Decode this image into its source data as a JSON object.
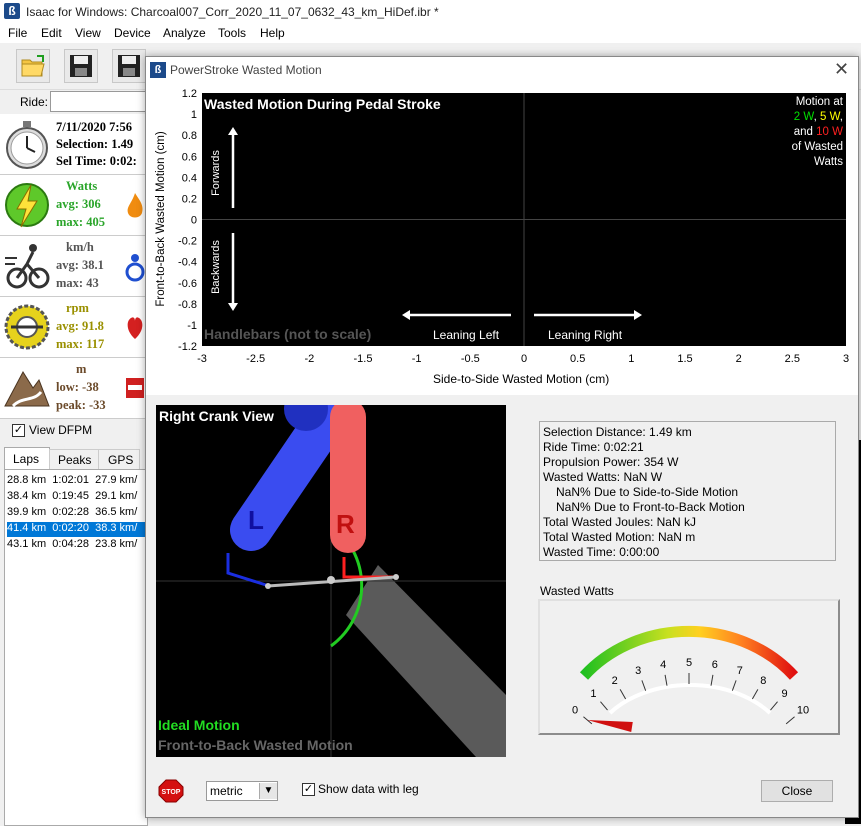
{
  "window": {
    "title": "Isaac for Windows:  Charcoal007_Corr_2020_11_07_0632_43_km_HiDef.ibr *",
    "menu": [
      "File",
      "Edit",
      "View",
      "Device",
      "Analyze",
      "Tools",
      "Help"
    ]
  },
  "ride": {
    "label": "Ride:"
  },
  "summary": {
    "date": "7/11/2020 7:56",
    "selection": "Selection: 1.49",
    "sel_time": "Sel Time: 0:02:"
  },
  "watts": {
    "label": "Watts",
    "avg": "avg: 306",
    "max": "max: 405"
  },
  "speed": {
    "label": "km/h",
    "avg": "avg: 38.1",
    "max": "max: 43"
  },
  "cadence": {
    "label": "rpm",
    "avg": "avg: 91.8",
    "max": "max: 117"
  },
  "elevation": {
    "label": "m",
    "low": "low: -38",
    "peak": "peak: -33"
  },
  "view_dfpm": "View DFPM",
  "tabs": [
    "Laps",
    "Peaks",
    "GPS"
  ],
  "laps": [
    [
      "28.8 km",
      "1:02:01",
      "27.9 km/"
    ],
    [
      "38.4 km",
      "0:19:45",
      "29.1 km/"
    ],
    [
      "39.9 km",
      "0:02:28",
      "36.5 km/"
    ],
    [
      "41.4 km",
      "0:02:20",
      "38.3 km/"
    ],
    [
      "43.1 km",
      "0:04:28",
      "23.8 km/"
    ]
  ],
  "dialog": {
    "title": "PowerStroke Wasted Motion",
    "plot": {
      "title": "Wasted Motion During Pedal Stroke",
      "ylabel": "Front-to-Back Wasted Motion (cm)",
      "xlabel": "Side-to-Side Wasted Motion (cm)",
      "yticks": [
        "1.2",
        "1",
        "0.8",
        "0.6",
        "0.4",
        "0.2",
        "0",
        "-0.2",
        "-0.4",
        "-0.6",
        "-0.8",
        "-1",
        "-1.2"
      ],
      "xticks": [
        "-3",
        "-2.5",
        "-2",
        "-1.5",
        "-1",
        "-0.5",
        "0",
        "0.5",
        "1",
        "1.5",
        "2",
        "2.5",
        "3"
      ],
      "forwards": "Forwards",
      "backwards": "Backwards",
      "leaning_left": "Leaning Left",
      "leaning_right": "Leaning Right",
      "handlebars": "Handlebars (not to scale)",
      "legend": {
        "line1": "Motion at",
        "v2": "2 W",
        "comma": ",",
        "v5": "5 W",
        "comma2": ",",
        "and": "and",
        "v10": "10 W",
        "line4": "of Wasted",
        "line5": "Watts",
        "colors": {
          "v2": "#00e000",
          "v5": "#ffff00",
          "v10": "#ff2020"
        }
      }
    },
    "crank": {
      "title": "Right Crank View",
      "left_label": "L",
      "right_label": "R",
      "ideal": "Ideal Motion",
      "wasted": "Front-to-Back Wasted Motion"
    },
    "stats": {
      "distance": "Selection Distance: 1.49 km",
      "ride_time": "Ride Time: 0:02:21",
      "propulsion": "Propulsion Power: 354 W",
      "wasted_watts": "Wasted Watts: NaN W",
      "side": "NaN% Due to Side-to-Side Motion",
      "front": "NaN% Due to Front-to-Back Motion",
      "joules": "Total Wasted Joules: NaN kJ",
      "motion": "Total Wasted Motion: NaN m",
      "time": "Wasted Time: 0:00:00"
    },
    "gauge": {
      "label": "Wasted Watts",
      "ticks": [
        "0",
        "1",
        "2",
        "3",
        "4",
        "5",
        "6",
        "7",
        "8",
        "9",
        "10"
      ],
      "value": 0
    },
    "units": "metric",
    "show_leg": "Show data with leg",
    "close": "Close",
    "stop": "STOP"
  }
}
